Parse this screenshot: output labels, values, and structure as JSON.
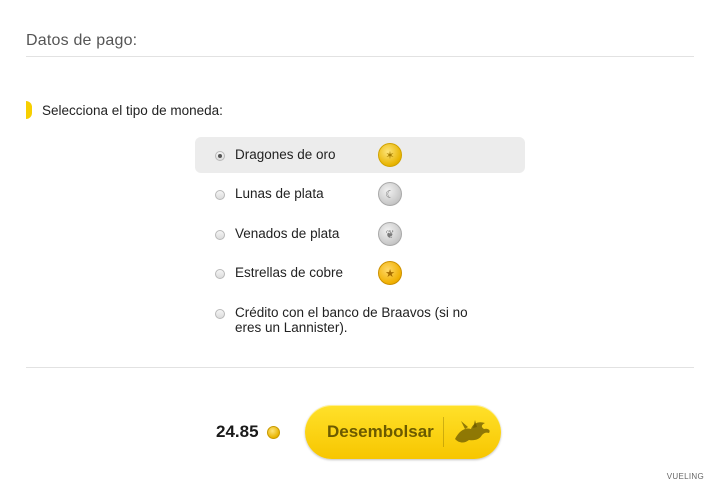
{
  "header": {
    "title": "Datos de pago:"
  },
  "prompt": {
    "label": "Selecciona el tipo de moneda:"
  },
  "options": [
    {
      "label": "Dragones de oro",
      "selected": true,
      "icon": "gold-dragon-coin-icon"
    },
    {
      "label": "Lunas de plata",
      "selected": false,
      "icon": "silver-moon-coin-icon"
    },
    {
      "label": "Venados de plata",
      "selected": false,
      "icon": "silver-stag-coin-icon"
    },
    {
      "label": "Estrellas de cobre",
      "selected": false,
      "icon": "copper-star-coin-icon"
    },
    {
      "label": "Crédito con el banco de Braavos (si no eres un Lannister).",
      "selected": false,
      "icon": ""
    }
  ],
  "total": {
    "amount": "24.85",
    "currency_icon": "gold-coin-icon"
  },
  "pay_button": {
    "label": "Desembolsar",
    "icon": "dragon-icon"
  },
  "credit": {
    "text": "VUELING"
  },
  "colors": {
    "accent": "#f7cf00",
    "selected_bg": "#ececec"
  }
}
